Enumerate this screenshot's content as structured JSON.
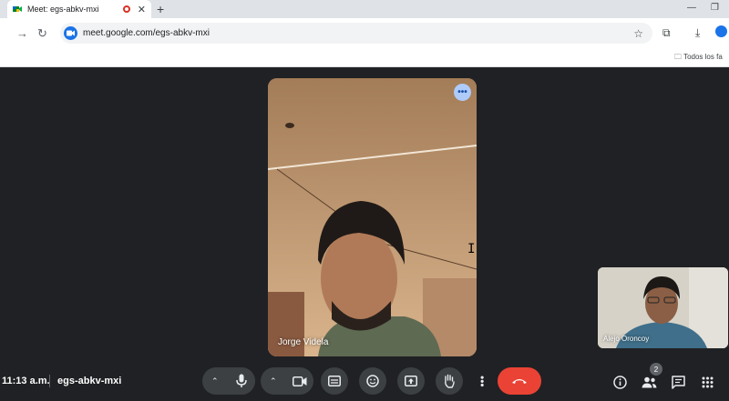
{
  "browser": {
    "tab_title": "Meet: egs-abkv-mxi",
    "url": "meet.google.com/egs-abkv-mxi",
    "bookmark_folder": "Todos los fa"
  },
  "meeting": {
    "main_participant": "Jorge Videla",
    "self_participant": "Alejo Oroncoy",
    "time": "11:13 a.m.",
    "code": "egs-abkv-mxi",
    "participant_count": "2"
  },
  "colors": {
    "accent": "#1a73e8",
    "end_call": "#ea4335",
    "control_bg": "#3c4043",
    "background": "#202124"
  },
  "icons": [
    "record-icon",
    "mic-icon",
    "camera-icon",
    "captions-icon",
    "emoji-icon",
    "present-icon",
    "raise-hand-icon",
    "more-options-icon",
    "end-call-icon",
    "info-icon",
    "people-icon",
    "chat-icon",
    "activities-icon"
  ]
}
